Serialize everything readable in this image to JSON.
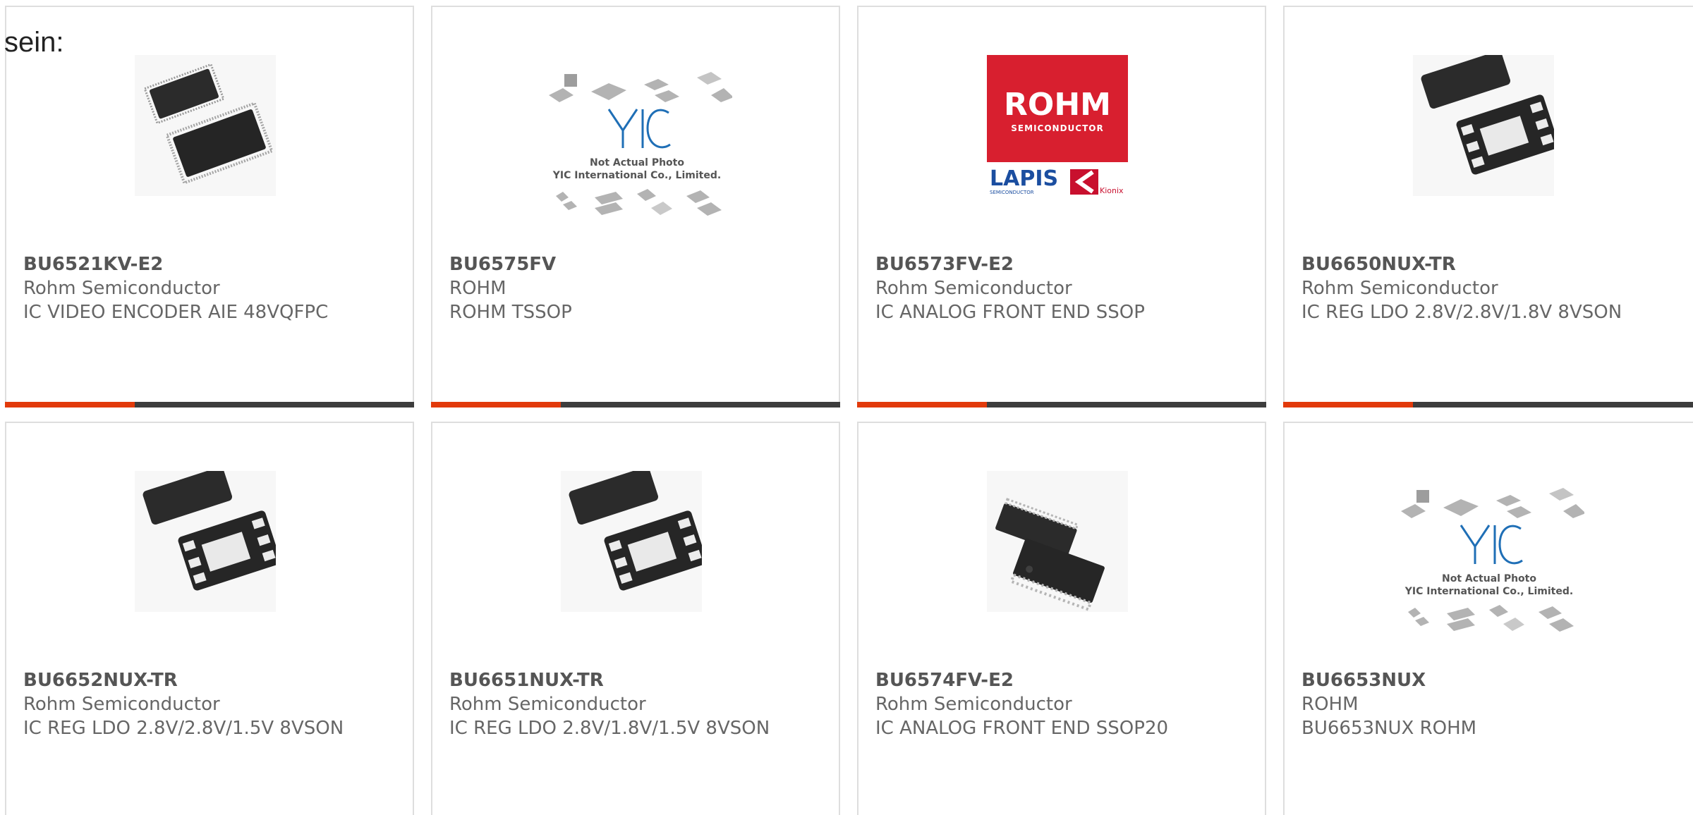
{
  "heading": "sein:",
  "colors": {
    "accent": "#e23a0b",
    "bar": "#3d3d3d",
    "border": "#dedede",
    "text": "#666666"
  },
  "products": [
    {
      "part": "BU6521KV-E2",
      "manufacturer": "Rohm Semiconductor",
      "desc": "IC VIDEO ENCODER AIE 48VQFPC",
      "image": "qfp-package-icon"
    },
    {
      "part": "BU6575FV",
      "manufacturer": "ROHM",
      "desc": "ROHM TSSOP",
      "image": "placeholder-photo-icon",
      "image_caption_1": "Not Actual Photo",
      "image_caption_2": "YIC International Co., Limited."
    },
    {
      "part": "BU6573FV-E2",
      "manufacturer": "Rohm Semiconductor",
      "desc": "IC ANALOG FRONT END SSOP",
      "image": "rohm-logo",
      "logo_text": "ROHM",
      "logo_sub": "SEMICONDUCTOR",
      "logo2": "LAPIS",
      "logo2_sub": "SEMICONDUCTOR",
      "logo3": "Kionix"
    },
    {
      "part": "BU6650NUX-TR",
      "manufacturer": "Rohm Semiconductor",
      "desc": "IC REG LDO 2.8V/2.8V/1.8V 8VSON",
      "image": "vson-package-icon"
    },
    {
      "part": "BU6652NUX-TR",
      "manufacturer": "Rohm Semiconductor",
      "desc": "IC REG LDO 2.8V/2.8V/1.5V 8VSON",
      "image": "vson-package-icon"
    },
    {
      "part": "BU6651NUX-TR",
      "manufacturer": "Rohm Semiconductor",
      "desc": "IC REG LDO 2.8V/1.8V/1.5V 8VSON",
      "image": "vson-package-icon"
    },
    {
      "part": "BU6574FV-E2",
      "manufacturer": "Rohm Semiconductor",
      "desc": "IC ANALOG FRONT END SSOP20",
      "image": "ssop-package-icon"
    },
    {
      "part": "BU6653NUX",
      "manufacturer": "ROHM",
      "desc": "BU6653NUX ROHM",
      "image": "placeholder-photo-icon",
      "image_caption_1": "Not Actual Photo",
      "image_caption_2": "YIC International Co., Limited."
    }
  ]
}
